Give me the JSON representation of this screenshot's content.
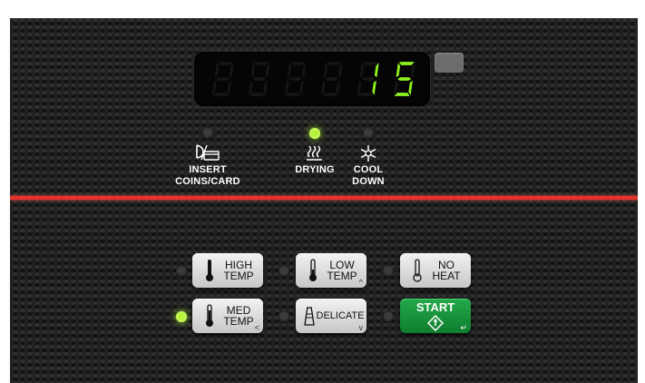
{
  "display": {
    "digits": [
      "8",
      "8",
      "8",
      "8",
      "1",
      "5"
    ],
    "active": [
      false,
      false,
      false,
      false,
      true,
      true
    ],
    "lit_color": "#8ef21f",
    "dim_color": "#151515"
  },
  "indicators": {
    "insert": {
      "label_1": "INSERT",
      "label_2": "COINS/CARD",
      "icon": "coin-card-icon",
      "on": false
    },
    "drying": {
      "label_1": "DRYING",
      "icon": "drying-heat-icon",
      "on": true
    },
    "cool_down": {
      "label_1": "COOL",
      "label_2": "DOWN",
      "icon": "snowflake-icon",
      "on": false
    }
  },
  "buttons": {
    "high_temp": {
      "line_1": "HIGH",
      "line_2": "TEMP",
      "icon": "thermometer-high-icon",
      "led_on": false
    },
    "low_temp": {
      "line_1": "LOW",
      "line_2": "TEMP",
      "corner": "^",
      "icon": "thermometer-low-icon",
      "led_on": false
    },
    "no_heat": {
      "line_1": "NO",
      "line_2": "HEAT",
      "icon": "thermometer-empty-icon",
      "led_on": false
    },
    "med_temp": {
      "line_1": "MED",
      "line_2": "TEMP",
      "corner": "<",
      "icon": "thermometer-med-icon",
      "led_on": true
    },
    "delicate": {
      "label": "DELICATE",
      "corner": "v",
      "icon": "delicate-garment-icon",
      "led_on": false
    },
    "start": {
      "label": "START",
      "corner": "↵",
      "icon": "start-diamond-icon",
      "led_on": false
    }
  },
  "colors": {
    "accent_red": "#e8322c",
    "start_green": "#1a9a40",
    "led_green": "#b6f33a"
  }
}
